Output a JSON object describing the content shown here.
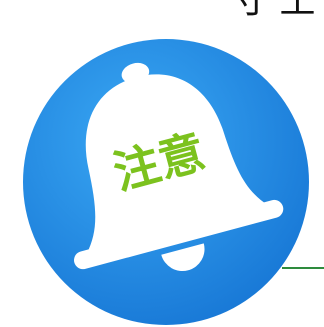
{
  "top_text": "寸 土",
  "badge": {
    "label": "注意",
    "color": "#7cc21e"
  },
  "icon": {
    "name": "bell-icon",
    "background_color": "#1f8fe6",
    "bell_color": "#ffffff"
  },
  "accent_line_color": "#2e8b3d"
}
